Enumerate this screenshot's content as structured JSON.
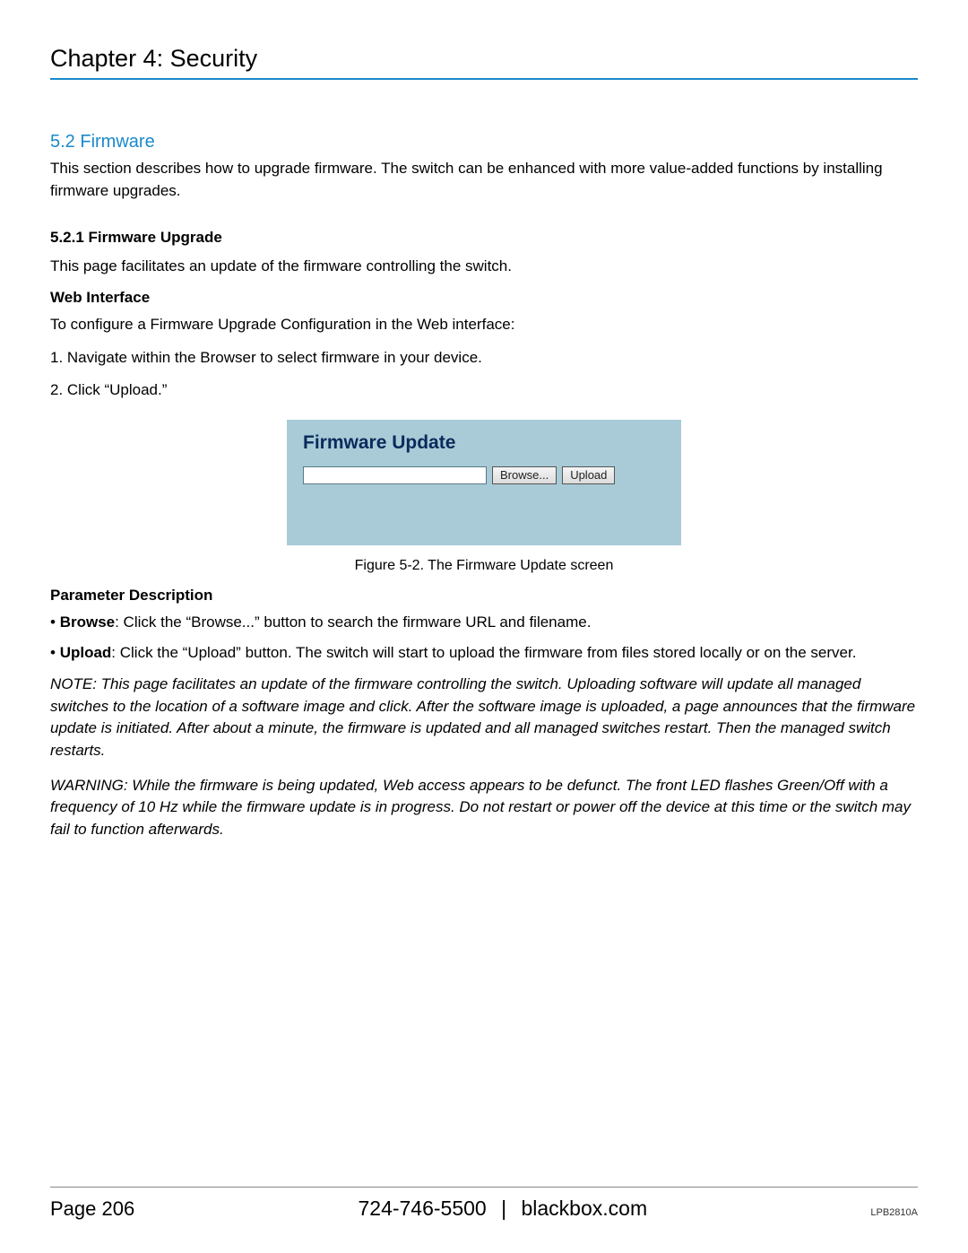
{
  "chapter": {
    "title": "Chapter 4: Security"
  },
  "section": {
    "heading": "5.2 Firmware",
    "intro": "This section describes how to upgrade firmware. The switch can be enhanced with more value-added functions by installing firmware upgrades."
  },
  "subsection": {
    "heading": "5.2.1 Firmware Upgrade",
    "desc": "This page facilitates an update of the firmware controlling the switch."
  },
  "webinterface": {
    "heading": "Web Interface",
    "intro": "To configure a Firmware Upgrade Configuration in the Web interface:",
    "step1": "1. Navigate within the Browser to select firmware in your device.",
    "step2": "2. Click “Upload.”"
  },
  "figure": {
    "panel_title": "Firmware Update",
    "input_value": "",
    "browse_label": "Browse...",
    "upload_label": "Upload",
    "caption": "Figure 5-2. The Firmware Update screen"
  },
  "params": {
    "heading": "Parameter Description",
    "browse_label": "Browse",
    "browse_text": ": Click the “Browse...” button to search the firmware URL and filename.",
    "upload_label": "Upload",
    "upload_text": ": Click the “Upload” button. The switch will start to upload the firmware from files stored locally or on the server."
  },
  "note": "NOTE: This page facilitates an update of the firmware controlling the switch. Uploading software will update all managed switches to the location of a software image and click. After the software image is uploaded, a page announces that the firmware update is initiated. After about a minute, the firmware is updated and all managed switches restart. Then the managed switch restarts.",
  "warning": "WARNING: While the firmware is being updated, Web access appears to be defunct. The front LED flashes Green/Off with a frequency of 10 Hz while the firmware update is in progress. Do not restart or power off the device at this time or the switch may fail to function afterwards.",
  "footer": {
    "page": "Page 206",
    "phone": "724-746-5500",
    "sep": "|",
    "site": "blackbox.com",
    "model": "LPB2810A"
  }
}
